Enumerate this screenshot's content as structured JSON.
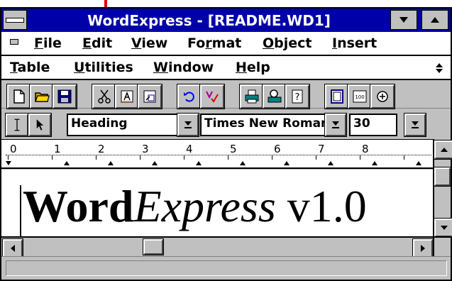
{
  "window": {
    "title": "WordExpress - [README.WD1]"
  },
  "menubar": {
    "row1": [
      {
        "mnemonic": "F",
        "rest": "ile"
      },
      {
        "mnemonic": "E",
        "rest": "dit"
      },
      {
        "mnemonic": "V",
        "rest": "iew"
      },
      {
        "pre": "Fo",
        "mnemonic": "r",
        "rest": "mat"
      },
      {
        "mnemonic": "O",
        "rest": "bject"
      },
      {
        "mnemonic": "I",
        "rest": "nsert"
      }
    ],
    "row2": [
      {
        "mnemonic": "T",
        "rest": "able"
      },
      {
        "mnemonic": "U",
        "rest": "tilities"
      },
      {
        "mnemonic": "W",
        "rest": "indow"
      },
      {
        "mnemonic": "H",
        "rest": "elp"
      }
    ]
  },
  "toolbar": {
    "icons": [
      "new-document-icon",
      "open-folder-icon",
      "save-disk-icon",
      "cut-scissors-icon",
      "copy-icon",
      "paste-icon",
      "undo-icon",
      "spell-check-icon",
      "print-icon",
      "print-preview-icon",
      "help-icon",
      "page-view-icon",
      "zoom-100-icon",
      "zoom-icon"
    ],
    "zoom_label": "100"
  },
  "formatbar": {
    "style_value": "Heading",
    "font_value": "Times New Roman",
    "size_value": "30"
  },
  "ruler": {
    "marks": [
      "0",
      "1",
      "2",
      "3",
      "4",
      "5",
      "6",
      "7",
      "8"
    ]
  },
  "document": {
    "bold_part": "Word",
    "italic_part": "Express",
    "plain_part": " v1.0"
  },
  "colors": {
    "titlebar": "#0000a8",
    "chrome": "#c0c0c0",
    "accent_red": "#e00000"
  }
}
